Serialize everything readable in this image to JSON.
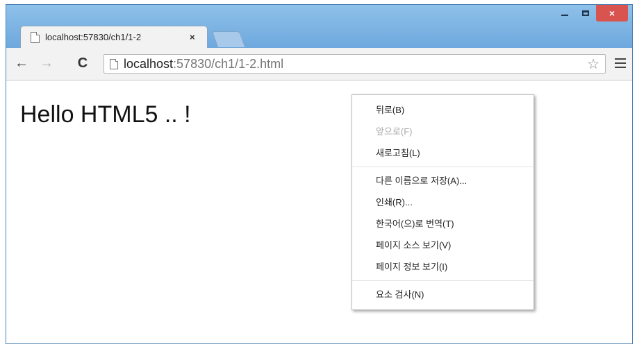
{
  "tab": {
    "title": "localhost:57830/ch1/1-2",
    "close_glyph": "×"
  },
  "window_controls": {
    "close_glyph": "×"
  },
  "toolbar": {
    "back_glyph": "←",
    "forward_glyph": "→",
    "reload_glyph": "C",
    "url_host": "localhost",
    "url_rest": ":57830/ch1/1-2.html",
    "star_glyph": "☆"
  },
  "page": {
    "heading": "Hello HTML5 .. !"
  },
  "context_menu": {
    "items": [
      {
        "label": "뒤로(B)",
        "enabled": true
      },
      {
        "label": "앞으로(F)",
        "enabled": false
      },
      {
        "label": "새로고침(L)",
        "enabled": true
      },
      {
        "label": "다른 이름으로 저장(A)...",
        "enabled": true
      },
      {
        "label": "인쇄(R)...",
        "enabled": true
      },
      {
        "label": "한국어(으)로 번역(T)",
        "enabled": true
      },
      {
        "label": "페이지 소스 보기(V)",
        "enabled": true
      },
      {
        "label": "페이지 정보 보기(I)",
        "enabled": true
      },
      {
        "label": "요소 검사(N)",
        "enabled": true
      }
    ]
  },
  "icons": {
    "tab_page": "page-icon",
    "omnibox_page": "page-icon",
    "bookmark": "star-icon",
    "menu": "hamburger-menu-icon"
  },
  "colors": {
    "titlebar": "#6fa8dc",
    "close_button": "#d9534f",
    "toolbar": "#f2f2f2"
  }
}
